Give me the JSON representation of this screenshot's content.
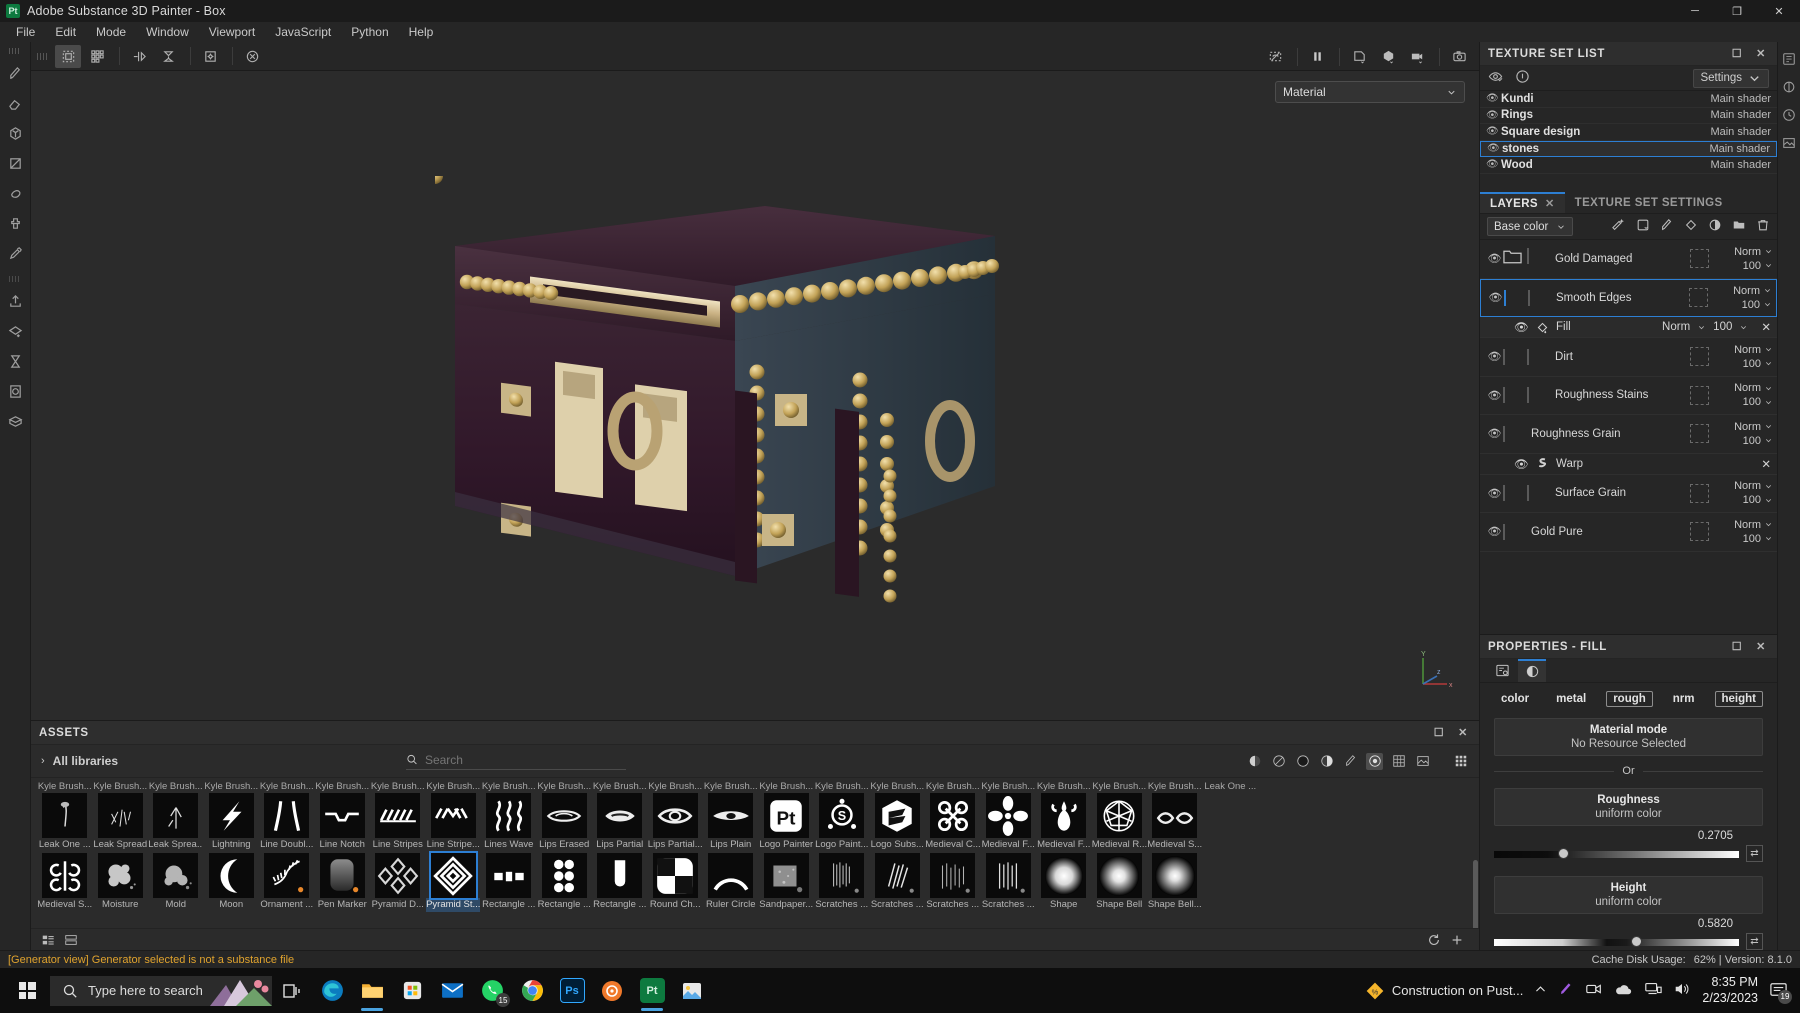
{
  "titlebar": {
    "app_title": "Adobe Substance 3D Painter - Box",
    "logo": "Pt",
    "minimize": "─",
    "maximize": "❐",
    "close": "✕"
  },
  "menu": {
    "items": [
      "File",
      "Edit",
      "Mode",
      "Window",
      "Viewport",
      "JavaScript",
      "Python",
      "Help"
    ]
  },
  "viewport": {
    "material_dropdown": "Material",
    "axis_x": "x",
    "axis_y": "Y",
    "axis_z": "z"
  },
  "assets": {
    "title": "ASSETS",
    "library": "All libraries",
    "search_placeholder": "Search",
    "row1": [
      {
        "top": "Kyle Brush...",
        "label": "Leak One ...",
        "icon": "leak-one"
      },
      {
        "top": "Kyle Brush...",
        "label": "Leak Spread",
        "icon": "leak-spread"
      },
      {
        "top": "Kyle Brush...",
        "label": "Leak Sprea...",
        "icon": "leak-spread2"
      },
      {
        "top": "Kyle Brush...",
        "label": "Lightning",
        "icon": "lightning"
      },
      {
        "top": "Kyle Brush...",
        "label": "Line Doubl...",
        "icon": "line-double"
      },
      {
        "top": "Kyle Brush...",
        "label": "Line Notch",
        "icon": "line-notch"
      },
      {
        "top": "Kyle Brush...",
        "label": "Line Stripes",
        "icon": "line-stripes"
      },
      {
        "top": "Kyle Brush...",
        "label": "Line Stripe...",
        "icon": "line-stripe2"
      },
      {
        "top": "Kyle Brush...",
        "label": "Lines Wave",
        "icon": "lines-wave"
      },
      {
        "top": "Kyle Brush...",
        "label": "Lips Erased",
        "icon": "lips-erased"
      },
      {
        "top": "Kyle Brush...",
        "label": "Lips Partial",
        "icon": "lips-partial"
      },
      {
        "top": "Kyle Brush...",
        "label": "Lips Partial...",
        "icon": "lips-partial2"
      },
      {
        "top": "Kyle Brush...",
        "label": "Lips Plain",
        "icon": "lips-plain"
      },
      {
        "top": "Kyle Brush...",
        "label": "Logo Painter",
        "icon": "logo-painter"
      },
      {
        "top": "Kyle Brush...",
        "label": "Logo Paint...",
        "icon": "logo-paint2"
      },
      {
        "top": "Kyle Brush...",
        "label": "Logo Subs...",
        "icon": "logo-substance"
      },
      {
        "top": "Kyle Brush...",
        "label": "Medieval C...",
        "icon": "medieval-c"
      },
      {
        "top": "Kyle Brush...",
        "label": "Medieval F...",
        "icon": "medieval-f1"
      },
      {
        "top": "Kyle Brush...",
        "label": "Medieval F...",
        "icon": "medieval-f2"
      },
      {
        "top": "Kyle Brush...",
        "label": "Medieval R...",
        "icon": "medieval-r"
      },
      {
        "top": "Kyle Brush...",
        "label": "Medieval S...",
        "icon": "medieval-s"
      },
      {
        "top": "Leak One ...",
        "label": "",
        "icon": "none"
      }
    ],
    "row2": [
      {
        "label": "Medieval S...",
        "icon": "medieval-swirl"
      },
      {
        "label": "Moisture",
        "icon": "moisture"
      },
      {
        "label": "Mold",
        "icon": "mold"
      },
      {
        "label": "Moon",
        "icon": "moon"
      },
      {
        "label": "Ornament ...",
        "icon": "ornament"
      },
      {
        "label": "Pen Marker",
        "icon": "pen-marker"
      },
      {
        "label": "Pyramid D...",
        "icon": "pyramid-d"
      },
      {
        "label": "Pyramid St...",
        "icon": "pyramid-st",
        "selected": true
      },
      {
        "label": "Rectangle ...",
        "icon": "rectangle1"
      },
      {
        "label": "Rectangle ...",
        "icon": "rectangle2"
      },
      {
        "label": "Rectangle ...",
        "icon": "rectangle3"
      },
      {
        "label": "Round Ch...",
        "icon": "round-check"
      },
      {
        "label": "Ruler Circle",
        "icon": "ruler-circle"
      },
      {
        "label": "Sandpaper...",
        "icon": "sandpaper"
      },
      {
        "label": "Scratches ...",
        "icon": "scratches1"
      },
      {
        "label": "Scratches ...",
        "icon": "scratches2"
      },
      {
        "label": "Scratches ...",
        "icon": "scratches3"
      },
      {
        "label": "Scratches ...",
        "icon": "scratches4"
      },
      {
        "label": "Shape",
        "icon": "shape"
      },
      {
        "label": "Shape Bell",
        "icon": "shape-bell"
      },
      {
        "label": "Shape Bell...",
        "icon": "shape-bell2"
      }
    ]
  },
  "texture_set_list": {
    "title": "TEXTURE SET LIST",
    "settings_label": "Settings",
    "rows": [
      {
        "name": "Kundi",
        "shader": "Main shader",
        "selected": false
      },
      {
        "name": "Rings",
        "shader": "Main shader",
        "selected": false
      },
      {
        "name": "Square design",
        "shader": "Main shader",
        "selected": false
      },
      {
        "name": "stones",
        "shader": "Main shader",
        "selected": true
      },
      {
        "name": "Wood",
        "shader": "Main shader",
        "selected": false
      }
    ]
  },
  "layers_panel": {
    "tab_layers": "LAYERS",
    "tab_settings": "TEXTURE SET SETTINGS",
    "channel_selector": "Base color",
    "layers": [
      {
        "name": "Gold Damaged",
        "blend": "Norm",
        "opacity": "100",
        "type": "folder",
        "selected": false,
        "thumb": "gold",
        "bar": "grey",
        "has_mask": true
      },
      {
        "name": "Smooth Edges",
        "blend": "Norm",
        "opacity": "100",
        "type": "layer",
        "selected": true,
        "thumb": "checker",
        "thumb2": "noise-white",
        "bar": "orange",
        "bar2": "orange",
        "has_mask": true,
        "child": {
          "name": "Fill",
          "blend": "Norm",
          "opacity": "100",
          "icon": "fill-icon"
        }
      },
      {
        "name": "Dirt",
        "blend": "Norm",
        "opacity": "100",
        "type": "layer",
        "selected": false,
        "thumb": "brown",
        "thumb2": "noise-grey",
        "bar": "grey",
        "bar2": "orange",
        "has_mask": true
      },
      {
        "name": "Roughness Stains",
        "blend": "Norm",
        "opacity": "100",
        "type": "layer",
        "selected": false,
        "thumb": "checker",
        "thumb2": "dark",
        "bar": "grey",
        "bar2": "orange",
        "has_mask": true
      },
      {
        "name": "Roughness Grain",
        "blend": "Norm",
        "opacity": "100",
        "type": "layer",
        "selected": false,
        "thumb": "checker",
        "bar": "orange",
        "has_mask": true,
        "child": {
          "name": "Warp",
          "icon": "warp-icon"
        }
      },
      {
        "name": "Surface Grain",
        "blend": "Norm",
        "opacity": "100",
        "type": "layer",
        "selected": false,
        "thumb": "checker",
        "thumb2": "noise-dark",
        "bar": "grey",
        "bar2": "orange",
        "has_mask": true
      },
      {
        "name": "Gold Pure",
        "blend": "Norm",
        "opacity": "100",
        "type": "layer",
        "selected": false,
        "thumb": "gold-solid",
        "has_mask": true
      }
    ]
  },
  "properties": {
    "title": "PROPERTIES - FILL",
    "channels": [
      {
        "label": "color",
        "on": false
      },
      {
        "label": "metal",
        "on": false
      },
      {
        "label": "rough",
        "on": true
      },
      {
        "label": "nrm",
        "on": false
      },
      {
        "label": "height",
        "on": true
      }
    ],
    "material_mode_title": "Material mode",
    "material_mode_value": "No Resource Selected",
    "or_label": "Or",
    "roughness_title": "Roughness",
    "roughness_sub": "uniform color",
    "roughness_value": "0.2705",
    "height_title": "Height",
    "height_sub": "uniform color",
    "height_value": "0.5820"
  },
  "statusbar": {
    "message": "[Generator view] Generator selected is not a substance file",
    "cache": "Cache Disk Usage:",
    "cache_value": "62% | Version: 8.1.0"
  },
  "taskbar": {
    "search_placeholder": "Type here to search",
    "whatsapp_badge": "15",
    "notif_badge": "19",
    "news_title": "Construction on Pust...",
    "time": "8:35 PM",
    "date": "2/23/2023",
    "apps": [
      {
        "name": "task-view",
        "label": ""
      },
      {
        "name": "edge",
        "label": ""
      },
      {
        "name": "file-explorer",
        "label": ""
      },
      {
        "name": "microsoft-store",
        "label": ""
      },
      {
        "name": "mail",
        "label": ""
      },
      {
        "name": "whatsapp",
        "label": ""
      },
      {
        "name": "chrome",
        "label": ""
      },
      {
        "name": "photoshop",
        "label": "Ps"
      },
      {
        "name": "substance-designer",
        "label": ""
      },
      {
        "name": "substance-painter",
        "label": "Pt"
      },
      {
        "name": "photos",
        "label": ""
      }
    ]
  },
  "colors": {
    "accent": "#2d7fd3",
    "orange": "#e8872a",
    "warning": "#e0a32e",
    "panel_bg": "#262626"
  }
}
